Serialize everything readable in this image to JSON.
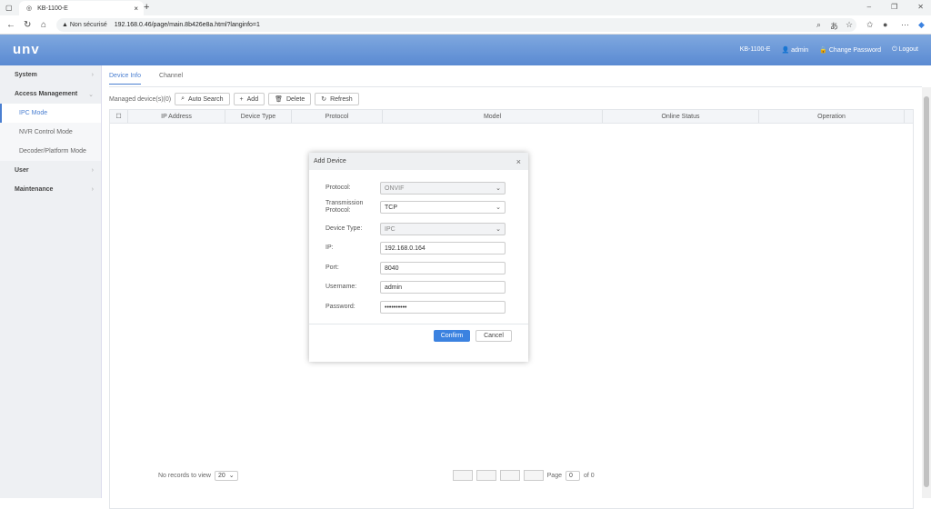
{
  "browser": {
    "tab_title": "KB-1100-E",
    "tab_close": "×",
    "new_tab": "+",
    "url_warning": "▲ Non sécurisé",
    "url": "192.168.0.46/page/main.8b426e8a.html?langinfo=1"
  },
  "header": {
    "logo": "unv",
    "device": "KB-1100-E",
    "user": "admin",
    "change_password": "Change Password",
    "logout": "Logout"
  },
  "sidebar": {
    "items": [
      {
        "label": "System"
      },
      {
        "label": "Access Management"
      },
      {
        "label": "IPC Mode"
      },
      {
        "label": "NVR Control Mode"
      },
      {
        "label": "Decoder/Platform Mode"
      },
      {
        "label": "User"
      },
      {
        "label": "Maintenance"
      }
    ]
  },
  "main": {
    "tabs": [
      "Device Info",
      "Channel"
    ],
    "managed": "Managed device(s)(0)",
    "buttons": {
      "auto_search": "Auto Search",
      "add": "Add",
      "delete": "Delete",
      "refresh": "Refresh"
    },
    "columns": [
      "IP Address",
      "Device Type",
      "Protocol",
      "Model",
      "Online Status",
      "Operation"
    ]
  },
  "pager": {
    "no_records": "No records to view",
    "per_page": "20",
    "page_label": "Page",
    "page_value": "0",
    "of": "of 0"
  },
  "modal": {
    "title": "Add Device",
    "close": "×",
    "fields": {
      "protocol": {
        "label": "Protocol:",
        "value": "ONVIF"
      },
      "transmission": {
        "label": "Transmission Protocol:",
        "value": "TCP"
      },
      "device_type": {
        "label": "Device Type:",
        "value": "IPC"
      },
      "ip": {
        "label": "IP:",
        "value": "192.168.0.164"
      },
      "port": {
        "label": "Port:",
        "value": "8040"
      },
      "username": {
        "label": "Username:",
        "value": "admin"
      },
      "password": {
        "label": "Password:",
        "value": "••••••••••"
      }
    },
    "confirm": "Confirm",
    "cancel": "Cancel"
  }
}
